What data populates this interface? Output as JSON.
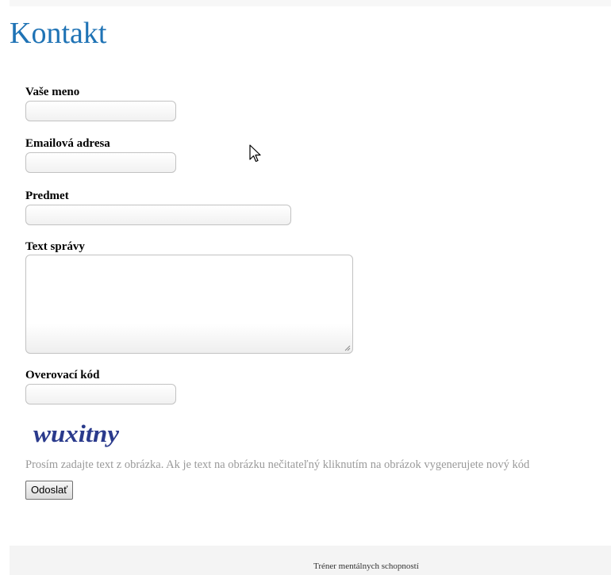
{
  "page": {
    "title": "Kontakt"
  },
  "form": {
    "name_label": "Vaše meno",
    "name_value": "",
    "email_label": "Emailová adresa",
    "email_value": "",
    "subject_label": "Predmet",
    "subject_value": "",
    "message_label": "Text správy",
    "message_value": "",
    "captcha_label": "Overovací kód",
    "captcha_value": "",
    "captcha_image_text": "wuxitny",
    "captcha_hint": "Prosím zadajte text z obrázka. Ak je text na obrázku nečitateľný kliknutím na obrázok vygenerujete nový kód",
    "submit_label": "Odoslať"
  },
  "footer": {
    "text": "Tréner mentálnych schopností"
  },
  "colors": {
    "title": "#1f73b5",
    "captcha": "#2a3a8c",
    "hint": "#9a9a9a"
  }
}
